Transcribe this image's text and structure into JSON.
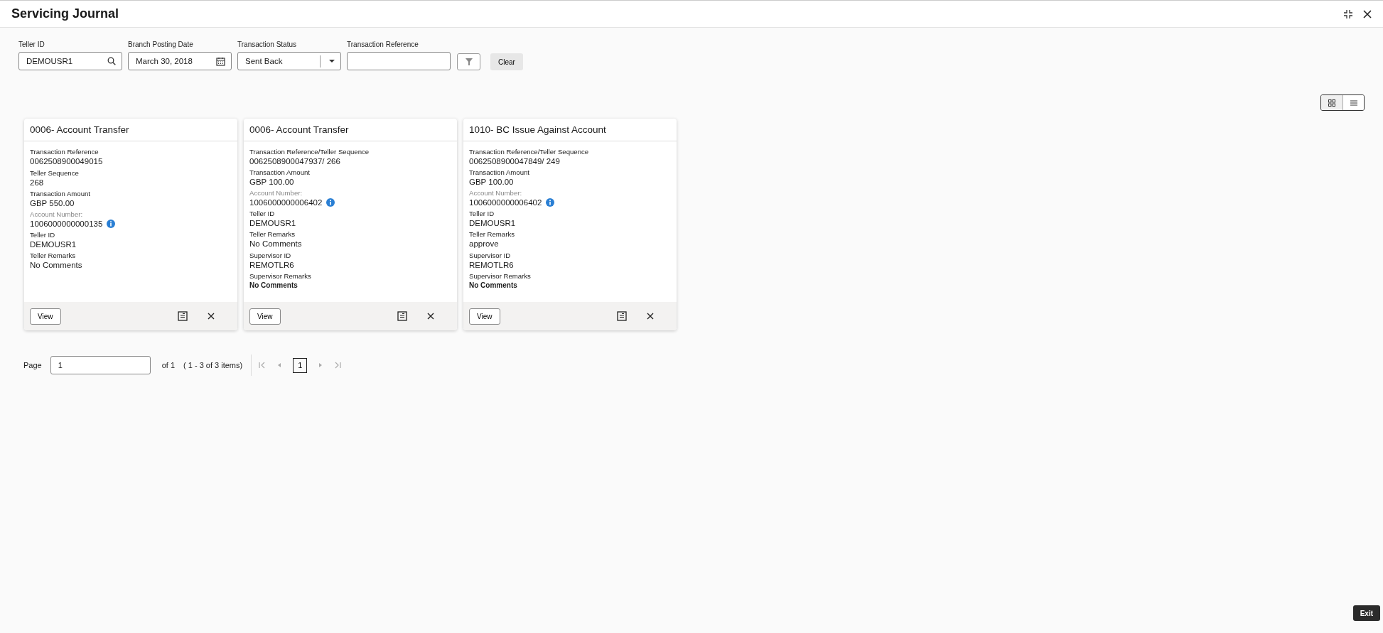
{
  "window": {
    "title": "Servicing Journal"
  },
  "filters": [
    {
      "kind": "search",
      "label": "Teller ID",
      "value": "DEMOUSR1"
    },
    {
      "kind": "date",
      "label": "Branch Posting Date",
      "value": "March 30, 2018"
    },
    {
      "kind": "select",
      "label": "Transaction Status",
      "value": "Sent Back"
    },
    {
      "kind": "text",
      "label": "Transaction Reference"
    }
  ],
  "clear_button": "Clear",
  "view_toggle": [
    {
      "kind": "grid",
      "selected": true
    },
    {
      "kind": "list",
      "selected": false
    }
  ],
  "cards": [
    {
      "title": "0006- Account Transfer",
      "fields": [
        {
          "kind": "plain",
          "label": "Transaction Reference",
          "value": "0062508900049015"
        },
        {
          "kind": "plain",
          "label": "Teller Sequence",
          "value": "268"
        },
        {
          "kind": "plain",
          "label": "Transaction Amount",
          "value": "GBP 550.00"
        },
        {
          "kind": "account",
          "label": "Account Number:",
          "value": "1006000000000135"
        },
        {
          "kind": "plain",
          "label": "Teller ID",
          "value": "DEMOUSR1"
        },
        {
          "kind": "plain",
          "label": "Teller Remarks",
          "value": "No Comments"
        }
      ],
      "view": "View"
    },
    {
      "title": "0006- Account Transfer",
      "fields": [
        {
          "kind": "plain",
          "label": "Transaction Reference/Teller Sequence",
          "value": "0062508900047937/ 266"
        },
        {
          "kind": "plain",
          "label": "Transaction Amount",
          "value": "GBP 100.00"
        },
        {
          "kind": "account",
          "label": "Account Number:",
          "value": "1006000000006402"
        },
        {
          "kind": "plain",
          "label": "Teller ID",
          "value": "DEMOUSR1"
        },
        {
          "kind": "plain",
          "label": "Teller Remarks",
          "value": "No Comments"
        },
        {
          "kind": "plain",
          "label": "Supervisor ID",
          "value": "REMOTLR6"
        },
        {
          "kind": "strong",
          "label": "Supervisor Remarks",
          "value": "No Comments"
        }
      ],
      "view": "View"
    },
    {
      "title": "1010- BC Issue Against Account",
      "fields": [
        {
          "kind": "plain",
          "label": "Transaction Reference/Teller Sequence",
          "value": "0062508900047849/ 249"
        },
        {
          "kind": "plain",
          "label": "Transaction Amount",
          "value": "GBP 100.00"
        },
        {
          "kind": "account",
          "label": "Account Number:",
          "value": "1006000000006402"
        },
        {
          "kind": "plain",
          "label": "Teller ID",
          "value": "DEMOUSR1"
        },
        {
          "kind": "plain",
          "label": "Teller Remarks",
          "value": "approve"
        },
        {
          "kind": "plain",
          "label": "Supervisor ID",
          "value": "REMOTLR6"
        },
        {
          "kind": "strong",
          "label": "Supervisor Remarks",
          "value": "No Comments"
        }
      ],
      "view": "View"
    }
  ],
  "pagination": {
    "label": "Page",
    "value": "1",
    "of": "of 1",
    "summary": "( 1 - 3 of 3 items)",
    "nav": [
      {
        "kind": "first",
        "disabled": true
      },
      {
        "kind": "prev",
        "disabled": true
      },
      {
        "kind": "page",
        "label": "1",
        "selected": true
      },
      {
        "kind": "next",
        "disabled": true
      },
      {
        "kind": "last",
        "disabled": true
      }
    ]
  },
  "exit_button": "Exit"
}
